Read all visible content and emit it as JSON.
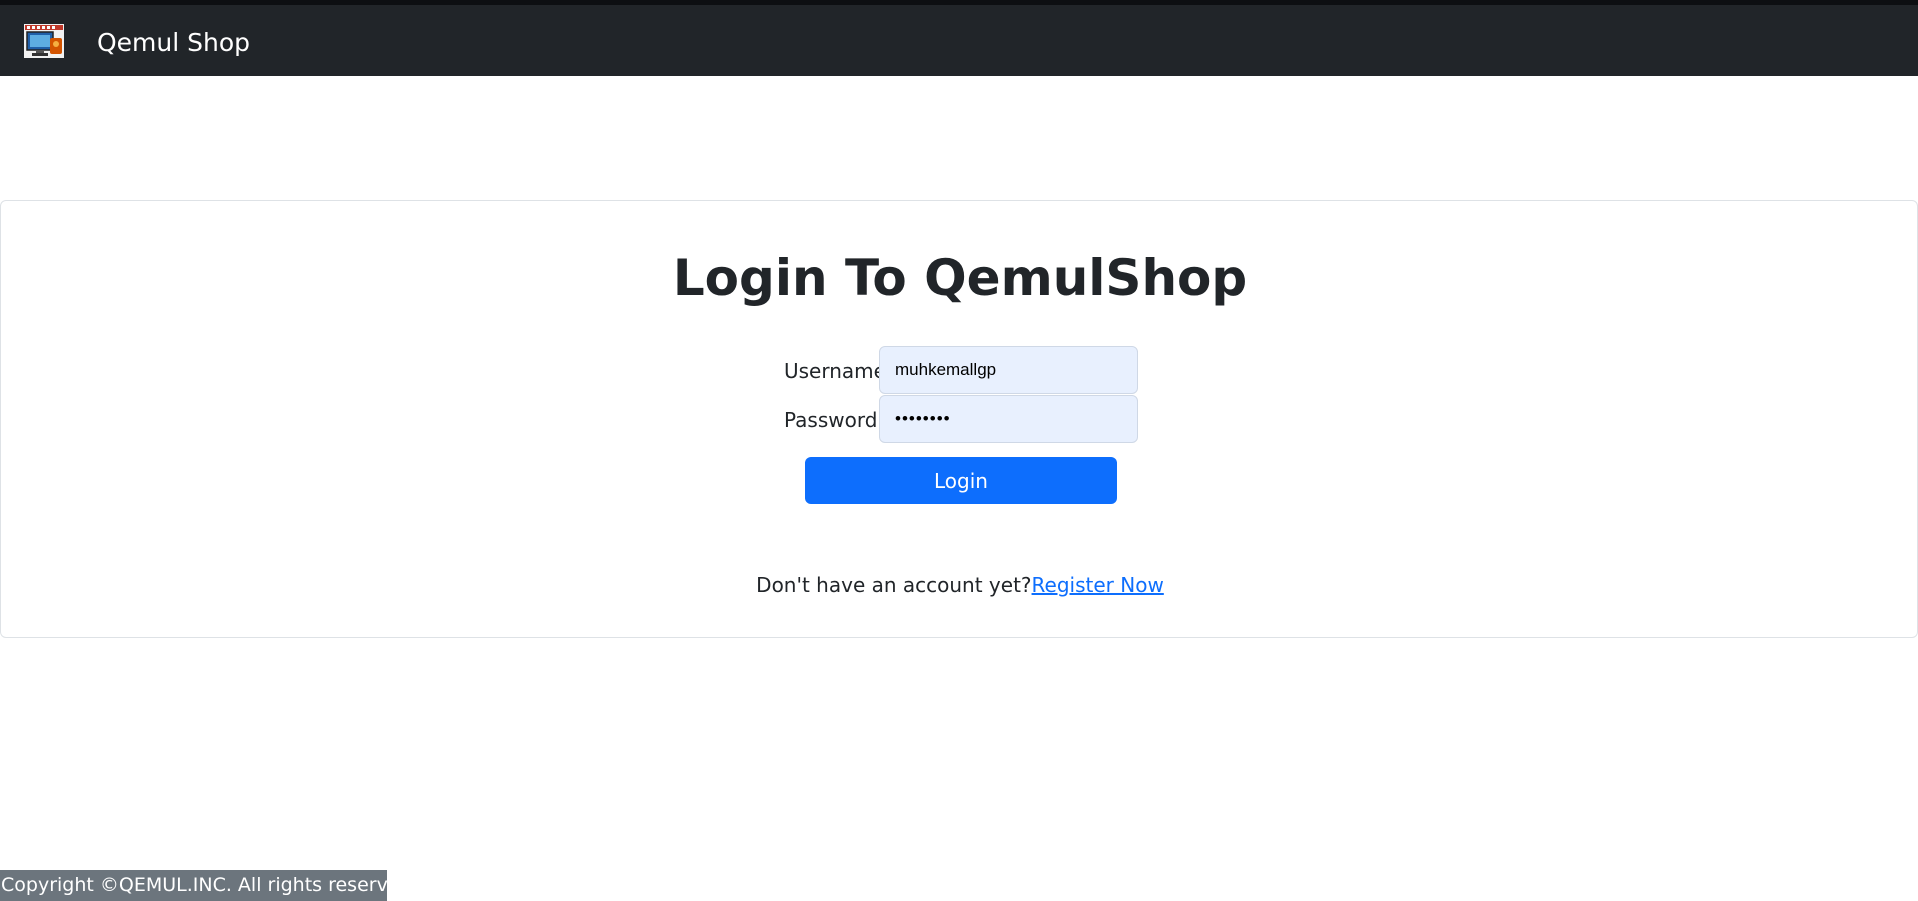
{
  "navbar": {
    "brand_name": "Qemul Shop",
    "logo_icon": "shop-logo-icon"
  },
  "login": {
    "title": "Login To QemulShop",
    "username_label": "Username:",
    "username_value": "muhkemallgp",
    "password_label": "Password:",
    "password_value": "••••••••",
    "login_button": "Login",
    "register_prompt": "Don't have an account yet?",
    "register_link": "Register Now"
  },
  "footer": {
    "copyright": "Copyright ©QEMUL.INC. All rights reserved."
  },
  "colors": {
    "navbar_bg": "#212529",
    "primary": "#0d6efd",
    "input_bg": "#e8f0fe",
    "footer_bg": "#6c757d"
  }
}
